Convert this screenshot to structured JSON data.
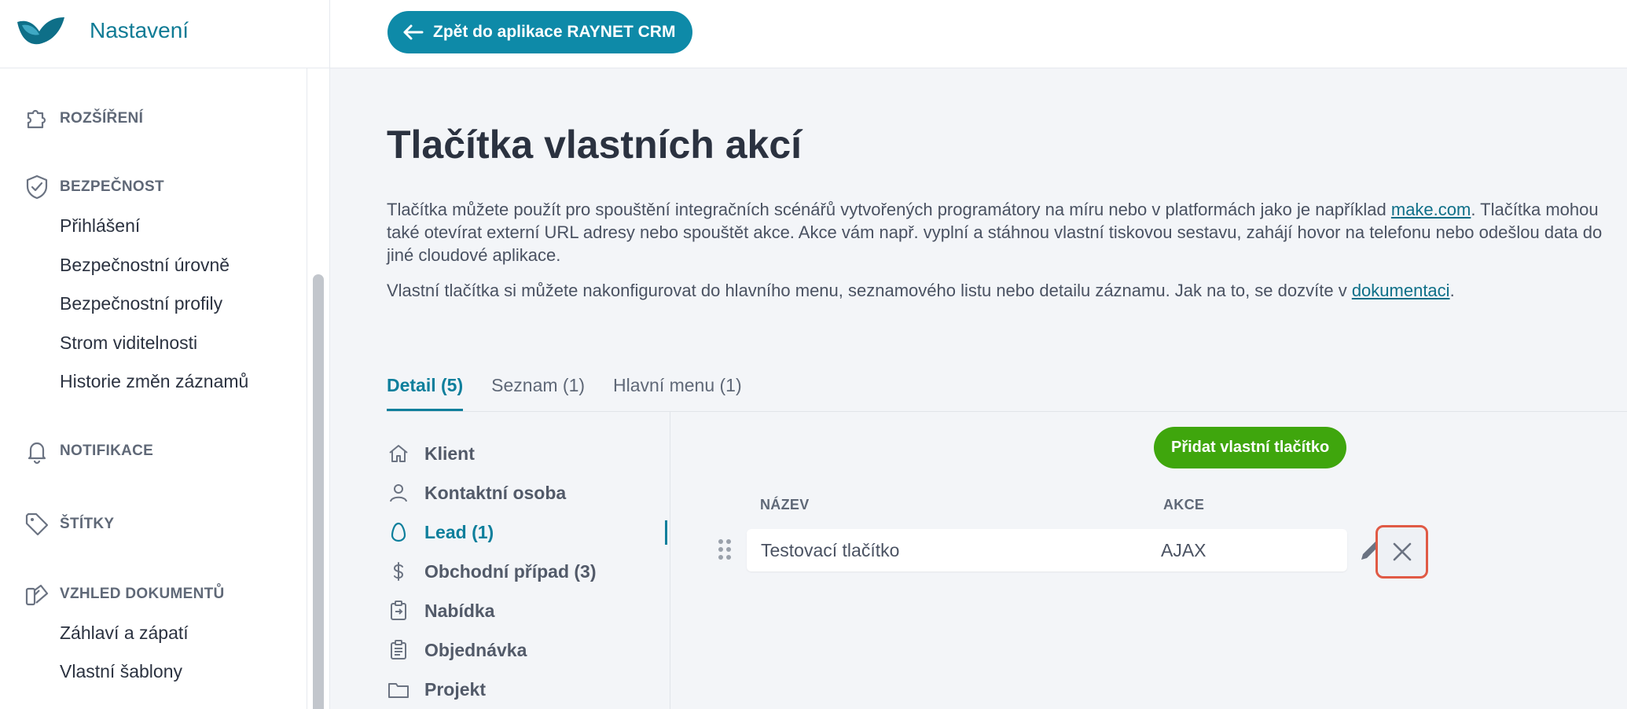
{
  "header": {
    "app_title": "Nastavení",
    "back_button_label": "Zpět do aplikace RAYNET CRM"
  },
  "sidebar": {
    "sections": [
      {
        "label": "ROZŠÍŘENÍ",
        "icon": "puzzle-icon",
        "items": []
      },
      {
        "label": "BEZPEČNOST",
        "icon": "shield-check-icon",
        "items": [
          "Přihlášení",
          "Bezpečnostní úrovně",
          "Bezpečnostní profily",
          "Strom viditelnosti",
          "Historie změn záznamů"
        ]
      },
      {
        "label": "NOTIFIKACE",
        "icon": "bell-icon",
        "items": []
      },
      {
        "label": "ŠTÍTKY",
        "icon": "tag-icon",
        "items": []
      },
      {
        "label": "VZHLED DOKUMENTŮ",
        "icon": "swatches-icon",
        "items": [
          "Záhlaví a zápatí",
          "Vlastní šablony"
        ]
      }
    ]
  },
  "main": {
    "title": "Tlačítka vlastních akcí",
    "paragraph1_part1": "Tlačítka můžete použít pro spouštění integračních scénářů vytvořených programátory na míru nebo v platformách jako je například ",
    "paragraph1_link": "make.com",
    "paragraph1_part2": ". Tlačítka mohou také otevírat externí URL adresy nebo spouštět akce. Akce vám např. vyplní a stáhnou vlastní tiskovou sestavu, zahájí hovor na telefonu nebo odešlou data do jiné cloudové aplikace.",
    "paragraph2_part1": "Vlastní tlačítka si můžete nakonfigurovat do hlavního menu, seznamového listu nebo detailu záznamu. Jak na to, se dozvíte v ",
    "paragraph2_link": "dokumentaci",
    "paragraph2_part2": ".",
    "tabs": [
      {
        "label": "Detail (5)",
        "active": true
      },
      {
        "label": "Seznam (1)",
        "active": false
      },
      {
        "label": "Hlavní menu (1)",
        "active": false
      }
    ],
    "entities": [
      {
        "label": "Klient",
        "icon": "home-icon"
      },
      {
        "label": "Kontaktní osoba",
        "icon": "person-icon"
      },
      {
        "label": "Lead (1)",
        "icon": "egg-icon",
        "active": true
      },
      {
        "label": "Obchodní případ (3)",
        "icon": "dollar-icon"
      },
      {
        "label": "Nabídka",
        "icon": "offer-icon"
      },
      {
        "label": "Objednávka",
        "icon": "clipboard-icon"
      },
      {
        "label": "Projekt",
        "icon": "folder-icon"
      }
    ],
    "add_button_label": "Přidat vlastní tlačítko",
    "table": {
      "columns": [
        "NÁZEV",
        "AKCE"
      ],
      "rows": [
        {
          "name": "Testovací tlačítko",
          "action": "AJAX"
        }
      ]
    }
  },
  "colors": {
    "accent": "#0e8aa8",
    "add_button": "#3fa60d",
    "highlight_border": "#e05a45"
  }
}
